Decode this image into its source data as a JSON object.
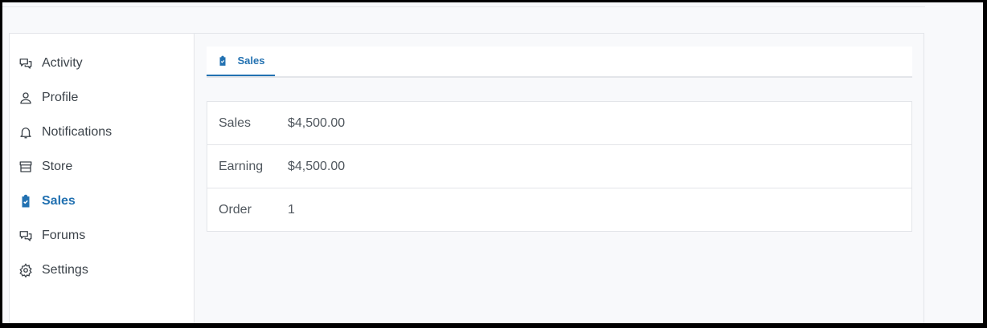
{
  "sidebar": {
    "items": [
      {
        "label": "Activity",
        "icon": "chat-bubbles-icon"
      },
      {
        "label": "Profile",
        "icon": "user-icon"
      },
      {
        "label": "Notifications",
        "icon": "bell-icon"
      },
      {
        "label": "Store",
        "icon": "store-icon"
      },
      {
        "label": "Sales",
        "icon": "clipboard-check-icon",
        "active": true
      },
      {
        "label": "Forums",
        "icon": "chat-bubbles-icon"
      },
      {
        "label": "Settings",
        "icon": "gear-icon"
      }
    ]
  },
  "tabs": [
    {
      "label": "Sales",
      "icon": "clipboard-check-icon",
      "active": true
    }
  ],
  "stats": [
    {
      "label": "Sales",
      "value": "$4,500.00"
    },
    {
      "label": "Earning",
      "value": "$4,500.00"
    },
    {
      "label": "Order",
      "value": "1"
    }
  ],
  "colors": {
    "accent": "#2271b1",
    "text": "#3c434a",
    "border": "#e3e5e9",
    "background": "#f8f9fb"
  }
}
